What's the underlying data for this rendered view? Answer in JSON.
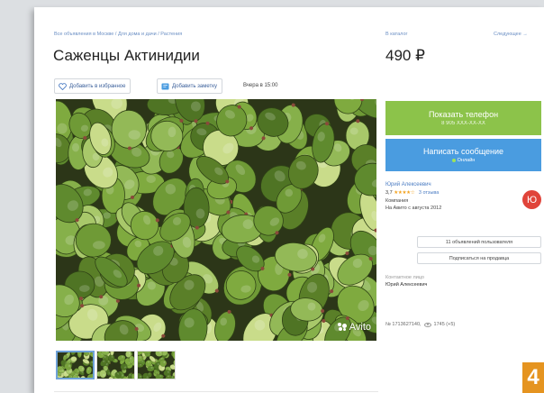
{
  "listing": {
    "breadcrumb": "Все объявления в Москве / Для дома и дачи / Растения",
    "title": "Саженцы Актинидии",
    "favorite_label": "Добавить в избранное",
    "note_label": "Добавить заметку",
    "date": "Вчера в 15:00",
    "watermark": "Avito"
  },
  "nav": {
    "catalog_link": "В каталог",
    "next_link": "Следующее →"
  },
  "price": "490 ₽",
  "actions": {
    "phone_label": "Показать телефон",
    "phone_masked": "8 905 XXX-XX-XX",
    "message_label": "Написать сообщение",
    "online_status": "Онлайн"
  },
  "seller": {
    "name": "Юрий Алексеевич",
    "rating": "3,7",
    "stars": "★★★★☆",
    "reviews": "3 отзыва",
    "type": "Компания",
    "since": "На Авито с августа 2012",
    "avatar_letter": "Ю",
    "listings_button": "11 объявлений пользователя",
    "subscribe_button": "Подписаться на продавца"
  },
  "contact": {
    "label": "Контактное лицо",
    "name": "Юрий Алексеевич"
  },
  "meta": {
    "ad_number": "№ 1713627140,",
    "views": "1745 (+5)"
  },
  "badge": "4",
  "colors": {
    "green": "#8cc34a",
    "blue": "#4a9ce0",
    "link": "#4a7bc2",
    "avatar": "#e0443a",
    "badge": "#e59420"
  }
}
